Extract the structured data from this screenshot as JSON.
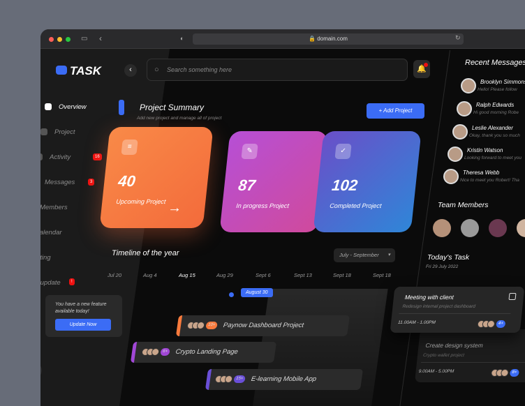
{
  "browser": {
    "url": "domain.com"
  },
  "brand": {
    "name": "TASK"
  },
  "search": {
    "placeholder": "Search something here"
  },
  "sidebar": {
    "items": [
      {
        "label": "Overview",
        "active": true
      },
      {
        "label": "Project"
      },
      {
        "label": "Activity",
        "badge": "16"
      },
      {
        "label": "Messages",
        "badge": "3"
      },
      {
        "label": "Members"
      },
      {
        "label": "Calendar"
      },
      {
        "label": "Setting"
      },
      {
        "label": "New update",
        "badge": "!"
      }
    ],
    "update_popup": {
      "text": "You have a new feature available today!",
      "button": "Update Now"
    }
  },
  "summary": {
    "title": "Project Summary",
    "subtitle": "Add new project and manage all of project",
    "add_button": "+ Add Project",
    "cards": [
      {
        "value": "40",
        "label": "Upcoming Project"
      },
      {
        "value": "87",
        "label": "In progress Project"
      },
      {
        "value": "102",
        "label": "Completed Project"
      }
    ]
  },
  "timeline": {
    "title": "Timeline of the year",
    "range": "July - September",
    "marker": "August 30",
    "dates": [
      "Jul 20",
      "Aug 4",
      "Aug 15",
      "Aug 29",
      "Sept 6",
      "Sept 13",
      "Sept 18",
      "Sept 18"
    ],
    "projects": [
      {
        "name": "Paynow Dashboard Project",
        "count": "10+",
        "color": "#f97a3c"
      },
      {
        "name": "Crypto Landing Page",
        "count": "6+",
        "color": "#a147d6"
      },
      {
        "name": "E-learning Mobile App",
        "count": "15+",
        "color": "#6a4fd8"
      }
    ]
  },
  "messages": {
    "title": "Recent Messages",
    "items": [
      {
        "name": "Brooklyn Simmons",
        "text": "Hello! Please follow"
      },
      {
        "name": "Ralph Edwards",
        "text": "Hi good morning Robe"
      },
      {
        "name": "Leslie Alexander",
        "text": "Okay, thank you so much"
      },
      {
        "name": "Kristin Watson",
        "text": "Looking forward to meet you"
      },
      {
        "name": "Theresa Webb",
        "text": "Nice to meet you Robert! Tha"
      }
    ]
  },
  "team": {
    "title": "Team Members"
  },
  "tasks": {
    "title": "Today's Task",
    "date": "Fri 29 July 2022",
    "items": [
      {
        "title": "Meeting with client",
        "sub": "Redesign internal project dashboard",
        "time": "11.00AM - 1.00PM",
        "count": "4+"
      },
      {
        "title": "Create design system",
        "sub": "Crypto wallet project",
        "time": "9.00AM - 5.00PM",
        "count": "8+"
      }
    ]
  }
}
